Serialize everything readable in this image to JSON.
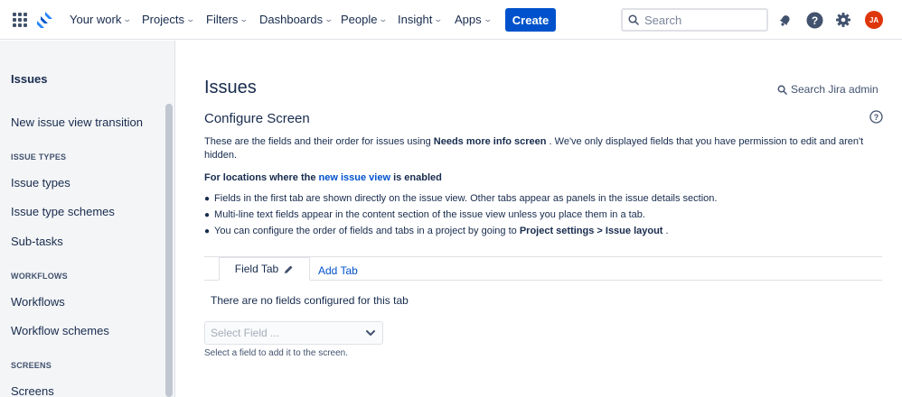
{
  "topnav": {
    "items": [
      {
        "label": "Your work"
      },
      {
        "label": "Projects"
      },
      {
        "label": "Filters"
      },
      {
        "label": "Dashboards"
      },
      {
        "label": "People"
      },
      {
        "label": "Insight"
      },
      {
        "label": "Apps"
      }
    ],
    "create_label": "Create",
    "search_placeholder": "Search",
    "avatar_initials": "JA",
    "avatar_color": "#de350b",
    "brand_color": "#0052cc",
    "icons": [
      "app-switcher-icon",
      "jira-logo-icon",
      "notifications-icon",
      "help-icon",
      "settings-icon"
    ]
  },
  "sidebar": {
    "title": "Issues",
    "top_link": "New issue view transition",
    "sections": [
      {
        "heading": "ISSUE TYPES",
        "items": [
          "Issue types",
          "Issue type schemes",
          "Sub-tasks"
        ]
      },
      {
        "heading": "WORKFLOWS",
        "items": [
          "Workflows",
          "Workflow schemes"
        ]
      },
      {
        "heading": "SCREENS",
        "items": [
          "Screens"
        ]
      }
    ]
  },
  "main": {
    "title": "Issues",
    "admin_search": "Search Jira admin",
    "section_title": "Configure Screen",
    "desc_prefix": "These are the fields and their order for issues using",
    "desc_screen": "Needs more info screen",
    "desc_suffix": ". We've only displayed fields that you have permission to edit and aren't hidden.",
    "loc_prefix": "For locations where the",
    "loc_link": "new issue view",
    "loc_suffix": "is enabled",
    "bullets": [
      {
        "text": "Fields in the first tab are shown directly on the issue view. Other tabs appear as panels in the issue details section."
      },
      {
        "text": "Multi-line text fields appear in the content section of the issue view unless you place them in a tab."
      },
      {
        "prefix": "You can configure the order of fields and tabs in a project by going to",
        "bold": "Project settings > Issue layout",
        "suffix": "."
      }
    ],
    "tabs": {
      "active": "Field Tab",
      "add": "Add Tab"
    },
    "empty_message": "There are no fields configured for this tab",
    "select_placeholder": "Select Field ...",
    "select_help": "Select a field to add it to the screen."
  }
}
